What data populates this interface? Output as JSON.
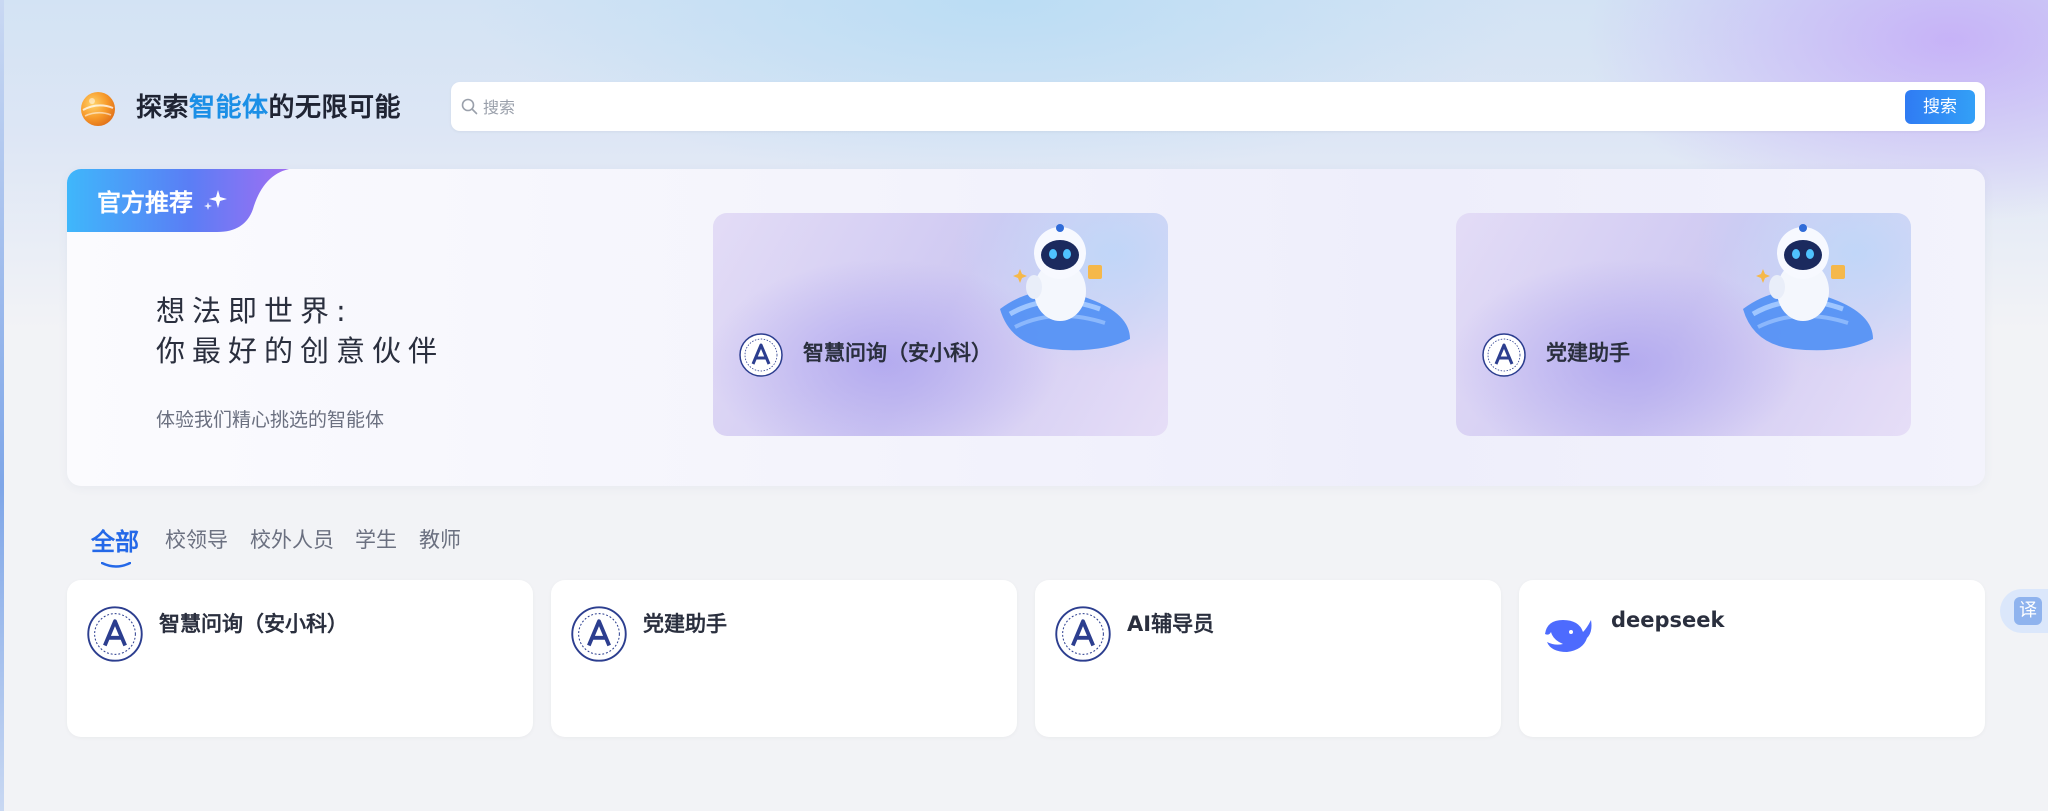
{
  "header": {
    "title_prefix": "探索",
    "title_highlight": "智能体",
    "title_suffix": "的无限可能",
    "logo_icon": "orange-planet-logo-icon"
  },
  "search": {
    "placeholder": "搜索",
    "value": "",
    "button_label": "搜索",
    "icon": "search-icon"
  },
  "recommend": {
    "tag_label": "官方推荐",
    "headline_line1": "想法即世界:",
    "headline_line2": "你最好的创意伙伴",
    "subtitle": "体验我们精心挑选的智能体",
    "cards": [
      {
        "name": "智慧问询（安小科）",
        "avatar": "school-emblem-icon"
      },
      {
        "name": "党建助手",
        "avatar": "school-emblem-icon"
      }
    ]
  },
  "tabs": [
    {
      "label": "全部",
      "active": true
    },
    {
      "label": "校领导",
      "active": false
    },
    {
      "label": "校外人员",
      "active": false
    },
    {
      "label": "学生",
      "active": false
    },
    {
      "label": "教师",
      "active": false
    }
  ],
  "agents": [
    {
      "name": "智慧问询（安小科）",
      "avatar": "school-emblem-icon"
    },
    {
      "name": "党建助手",
      "avatar": "school-emblem-icon"
    },
    {
      "name": "AI辅导员",
      "avatar": "school-emblem-icon"
    },
    {
      "name": "deepseek",
      "avatar": "deepseek-whale-icon"
    }
  ],
  "translate": {
    "label": "译"
  },
  "colors": {
    "accent": "#2468e8",
    "title_highlight": "#1b8fe6",
    "text_dark": "#2a2f3e",
    "text_muted": "#6b7080"
  }
}
